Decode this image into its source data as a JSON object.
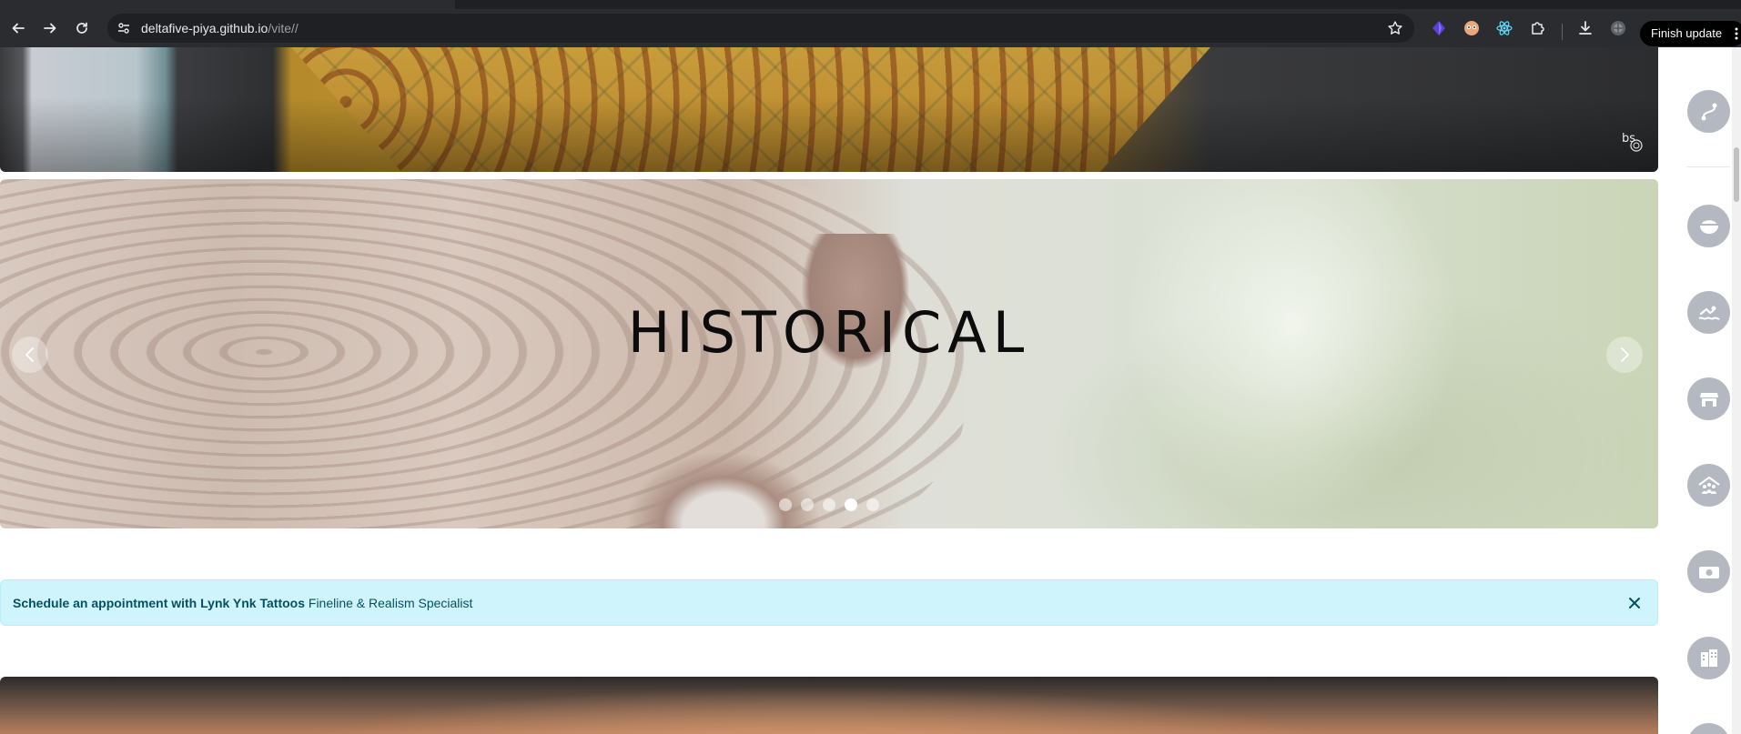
{
  "browser": {
    "url_host": "deltafive-piya.github.io",
    "url_path": "/vite//",
    "finish_update_label": "Finish update",
    "icons": {
      "back": "back-arrow-icon",
      "forward": "forward-arrow-icon",
      "reload": "reload-icon",
      "site_info": "site-info-icon",
      "bookmark": "star-icon",
      "extensions": "puzzle-icon",
      "download": "download-icon",
      "menu": "kebab-menu-icon"
    }
  },
  "top_banner": {
    "watermark": "bs"
  },
  "carousel": {
    "caption": "HISTORICAL",
    "slide_count": 5,
    "active_index": 3,
    "prev_icon": "chevron-left-icon",
    "next_icon": "chevron-right-icon"
  },
  "alert": {
    "strong_text": "Schedule an appointment with Lynk Ynk Tattoos",
    "text": "Fineline & Realism Specialist",
    "close_icon": "close-icon",
    "background": "#cff4fc",
    "color": "#055160"
  },
  "sidebar": {
    "button_color": "#b4b8c0",
    "items": [
      {
        "icon": "route-icon"
      },
      {
        "icon": "bowl-icon"
      },
      {
        "icon": "swimmer-icon"
      },
      {
        "icon": "store-icon"
      },
      {
        "icon": "people-roof-icon"
      },
      {
        "icon": "money-bill-icon"
      },
      {
        "icon": "building-icon"
      },
      {
        "icon": "more-icon"
      }
    ]
  }
}
